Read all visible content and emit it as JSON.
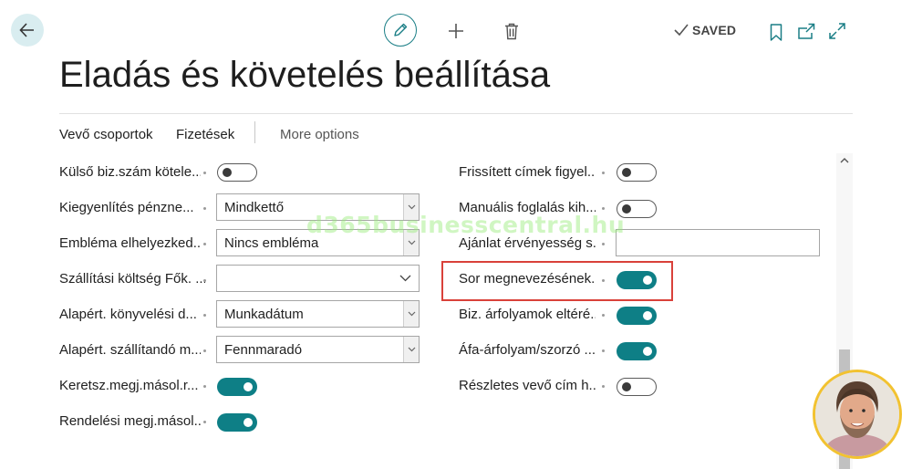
{
  "header": {
    "title": "Eladás és követelés beállítása",
    "saved_label": "SAVED"
  },
  "actions": {
    "customer_groups": "Vevő csoportok",
    "payments": "Fizetések",
    "more_options": "More options"
  },
  "fields_left": [
    {
      "label": "Külső biz.szám kötele...",
      "type": "toggle",
      "value": false
    },
    {
      "label": "Kiegyenlítés pénzne...",
      "type": "select",
      "value": "Mindkettő"
    },
    {
      "label": "Embléma elhelyezked...",
      "type": "select",
      "value": "Nincs embléma"
    },
    {
      "label": "Szállítási költség Fők. ...",
      "type": "select",
      "value": ""
    },
    {
      "label": "Alapért. könyvelési d...",
      "type": "select",
      "value": "Munkadátum"
    },
    {
      "label": "Alapért. szállítandó m...",
      "type": "select",
      "value": "Fennmaradó"
    },
    {
      "label": "Keretsz.megj.másol.r...",
      "type": "toggle",
      "value": true
    },
    {
      "label": "Rendelési megj.másol...",
      "type": "toggle",
      "value": true
    }
  ],
  "fields_right": [
    {
      "label": "Frissített címek figyel...",
      "type": "toggle",
      "value": false
    },
    {
      "label": "Manuális foglalás kih...",
      "type": "toggle",
      "value": false
    },
    {
      "label": "Ajánlat érvényesség s...",
      "type": "text",
      "value": ""
    },
    {
      "label": "Sor megnevezésének...",
      "type": "toggle",
      "value": true
    },
    {
      "label": "Biz. árfolyamok eltéré...",
      "type": "toggle",
      "value": true
    },
    {
      "label": "Áfa-árfolyam/szorzó ...",
      "type": "toggle",
      "value": true
    },
    {
      "label": "Részletes vevő cím h...",
      "type": "toggle",
      "value": false
    }
  ],
  "watermark": "d365businesscentral.hu",
  "colors": {
    "accent": "#0e7f86",
    "highlight": "#d9413a",
    "back_button_bg": "#d9edf0"
  }
}
